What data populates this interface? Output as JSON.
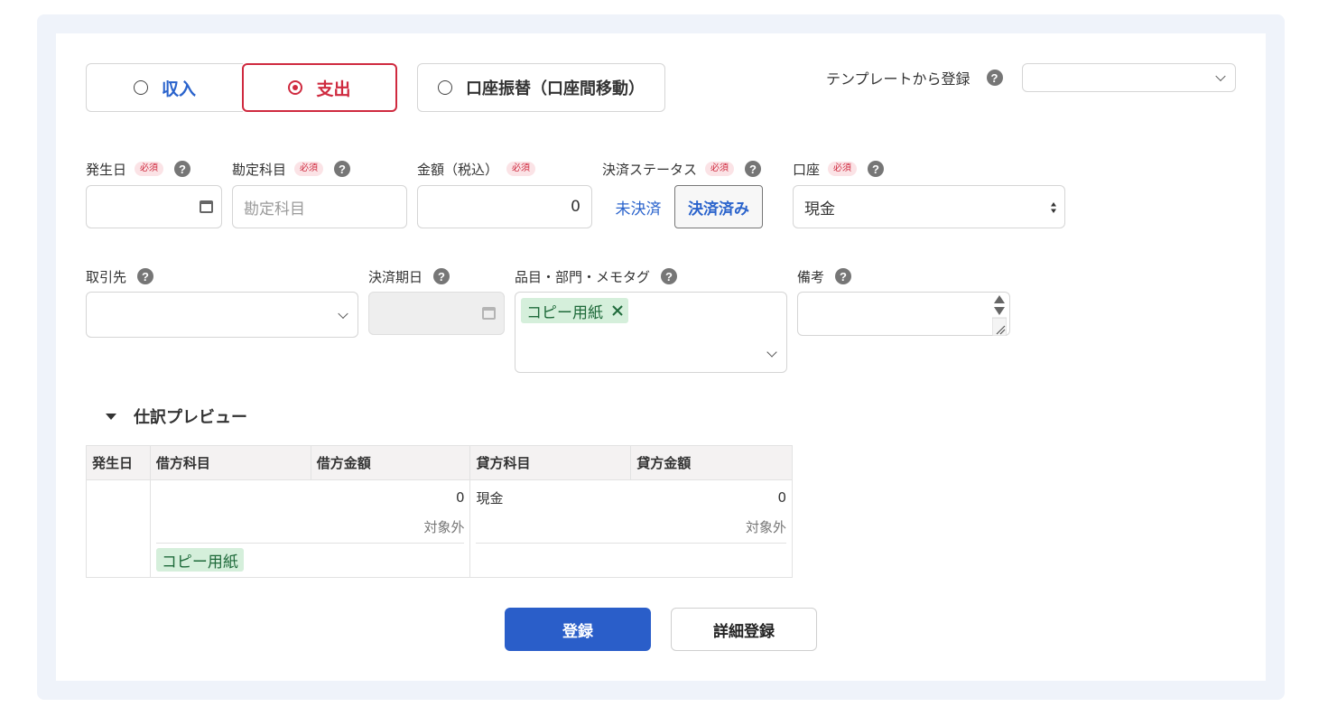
{
  "type_toggle": {
    "income_label": "収入",
    "expense_label": "支出",
    "transfer_label": "口座振替（口座間移動）",
    "selected": "expense"
  },
  "template": {
    "label": "テンプレートから登録",
    "value": ""
  },
  "help_glyph": "?",
  "required_badge": "必須",
  "fields": {
    "date": {
      "label": "発生日",
      "value": ""
    },
    "account_item": {
      "label": "勘定科目",
      "placeholder": "勘定科目"
    },
    "amount": {
      "label": "金額（税込）",
      "value": "0"
    },
    "status": {
      "label": "決済ステータス",
      "options": [
        "未決済",
        "決済済み"
      ],
      "selected": "決済済み"
    },
    "wallet": {
      "label": "口座",
      "value": "現金"
    },
    "partner": {
      "label": "取引先",
      "value": ""
    },
    "due_date": {
      "label": "決済期日",
      "value": ""
    },
    "tags": {
      "label": "品目・部門・メモタグ",
      "items": [
        "コピー用紙"
      ]
    },
    "memo": {
      "label": "備考",
      "value": ""
    }
  },
  "preview": {
    "title": "仕訳プレビュー",
    "columns": [
      "発生日",
      "借方科目",
      "借方金額",
      "貸方科目",
      "貸方金額"
    ],
    "row": {
      "date": "",
      "debit_item": "",
      "debit_amount": "0",
      "debit_tax": "対象外",
      "debit_tag": "コピー用紙",
      "credit_item": "現金",
      "credit_amount": "0",
      "credit_tax": "対象外"
    }
  },
  "actions": {
    "submit": "登録",
    "detail": "詳細登録"
  },
  "colors": {
    "accent_blue": "#2a5ec9",
    "expense_red": "#cf2a3f",
    "tag_green": "#d5efdb"
  }
}
